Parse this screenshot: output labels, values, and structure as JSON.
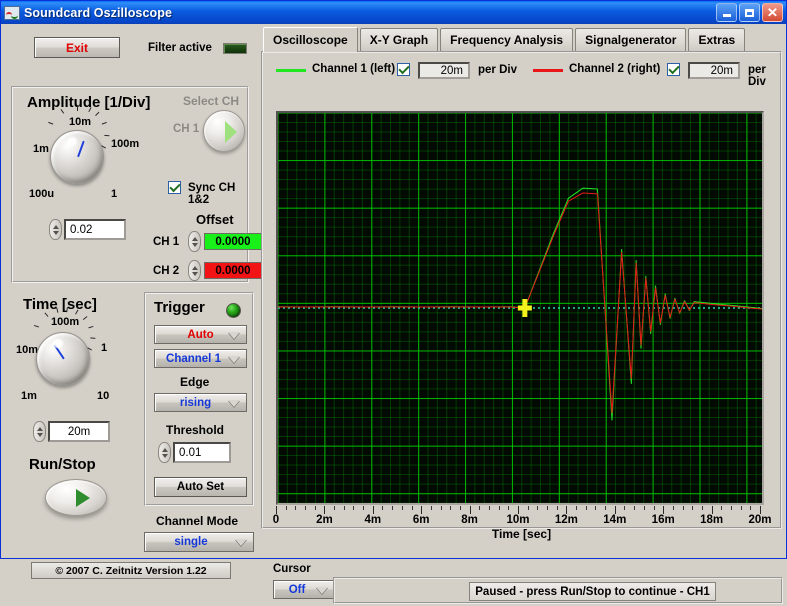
{
  "window": {
    "title": "Soundcard Oszilloscope",
    "icon": "oscilloscope-icon",
    "minimize": "minimize-icon",
    "maximize": "maximize-icon",
    "close": "✕"
  },
  "toolbar": {
    "exit_label": "Exit",
    "filter_label": "Filter active",
    "filter_led": "off"
  },
  "amplitude": {
    "title": "Amplitude [1/Div]",
    "knob_labels": [
      "1m",
      "10m",
      "100m",
      "1",
      "100u"
    ],
    "value": "0.02",
    "select_ch_label": "Select CH",
    "ch_label": "CH 1",
    "sync_label": "Sync CH 1&2",
    "sync_checked": true,
    "offset_title": "Offset",
    "ch1_label": "CH 1",
    "ch1_offset": "0.0000",
    "ch1_color": "#19f019",
    "ch2_label": "CH 2",
    "ch2_offset": "0.0000",
    "ch2_color": "#f21414"
  },
  "time": {
    "title": "Time [sec]",
    "knob_labels": [
      "10m",
      "100m",
      "1",
      "10",
      "1m"
    ],
    "value": "20m"
  },
  "runstop": {
    "title": "Run/Stop"
  },
  "trigger": {
    "title": "Trigger",
    "led": "on",
    "mode": "Auto",
    "source": "Channel 1",
    "edge_label": "Edge",
    "edge": "rising",
    "threshold_label": "Threshold",
    "threshold": "0.01",
    "autoset_label": "Auto Set"
  },
  "channel_mode": {
    "label": "Channel Mode",
    "value": "single"
  },
  "copyright": "© 2007   C. Zeitnitz Version 1.22",
  "tabs": [
    {
      "label": "Oscilloscope",
      "active": true
    },
    {
      "label": "X-Y Graph",
      "active": false
    },
    {
      "label": "Frequency Analysis",
      "active": false
    },
    {
      "label": "Signalgenerator",
      "active": false
    },
    {
      "label": "Extras",
      "active": false
    }
  ],
  "channels": [
    {
      "label": "Channel 1 (left)",
      "color": "#22e622",
      "enabled": true,
      "per_div": "20m",
      "per_div_label": "per Div"
    },
    {
      "label": "Channel 2 (right)",
      "color": "#e81616",
      "enabled": true,
      "per_div": "20m",
      "per_div_label": "per Div"
    }
  ],
  "cursor": {
    "label": "Cursor",
    "value": "Off"
  },
  "status": {
    "message": "Paused - press Run/Stop to continue - CH1"
  },
  "chart_data": {
    "type": "line",
    "title": "",
    "xlabel": "Time [sec]",
    "ylabel": "",
    "xlim": [
      0,
      0.02
    ],
    "ylim": [
      -0.08,
      0.08
    ],
    "xticks": [
      "0",
      "2m",
      "4m",
      "6m",
      "8m",
      "10m",
      "12m",
      "14m",
      "16m",
      "18m",
      "20m"
    ],
    "grid": true,
    "grid_color": "#00be00",
    "background": "#030a03",
    "legend_position": "top",
    "trigger_marker": {
      "x": 0.0102,
      "y": 0.0,
      "color": "#f2f21c"
    },
    "cursor_line": {
      "y": 0.0,
      "color": "#2ad8b0",
      "style": "dotted"
    },
    "series": [
      {
        "name": "Channel 1 (left)",
        "color": "#22e622",
        "x": [
          0.0,
          0.0012,
          0.0024,
          0.0036,
          0.0048,
          0.006,
          0.0072,
          0.0084,
          0.0096,
          0.0102,
          0.0108,
          0.0114,
          0.012,
          0.0126,
          0.0132,
          0.0138,
          0.0142,
          0.0146,
          0.0148,
          0.015,
          0.0152,
          0.0154,
          0.0156,
          0.0158,
          0.016,
          0.0162,
          0.0164,
          0.0166,
          0.0168,
          0.017,
          0.0172,
          0.0176,
          0.018,
          0.0184,
          0.0188,
          0.0192,
          0.0196,
          0.02
        ],
        "y": [
          0.0005,
          0.0004,
          0.0005,
          0.0004,
          0.0005,
          0.0004,
          0.0005,
          0.0004,
          0.0005,
          0.0,
          0.0155,
          0.031,
          0.045,
          0.0492,
          0.0488,
          -0.046,
          0.024,
          -0.031,
          0.0195,
          -0.0165,
          0.013,
          -0.0105,
          0.009,
          -0.0068,
          0.0058,
          -0.0042,
          0.004,
          -0.0022,
          0.003,
          -0.001,
          0.0026,
          0.0022,
          0.0018,
          0.0014,
          0.001,
          0.0006,
          0.0002,
          -0.0002
        ],
        "linewidth": 1
      },
      {
        "name": "Channel 2 (right)",
        "color": "#e81616",
        "x": [
          0.0,
          0.0012,
          0.0024,
          0.0036,
          0.0048,
          0.006,
          0.0072,
          0.0084,
          0.0096,
          0.0102,
          0.0108,
          0.0114,
          0.012,
          0.0126,
          0.0132,
          0.0138,
          0.0142,
          0.0146,
          0.0148,
          0.015,
          0.0152,
          0.0154,
          0.0156,
          0.0158,
          0.016,
          0.0162,
          0.0164,
          0.0166,
          0.0168,
          0.017,
          0.0172,
          0.0176,
          0.018,
          0.0184,
          0.0188,
          0.0192,
          0.0196,
          0.02
        ],
        "y": [
          0.0004,
          0.0004,
          0.0004,
          0.0004,
          0.0004,
          0.0004,
          0.0004,
          0.0004,
          0.0004,
          0.0,
          0.015,
          0.03,
          0.0438,
          0.0472,
          0.0468,
          -0.043,
          0.0228,
          -0.0288,
          0.0184,
          -0.0152,
          0.0122,
          -0.0096,
          0.0082,
          -0.0062,
          0.0052,
          -0.0038,
          0.0036,
          -0.002,
          0.0026,
          -0.0008,
          0.0022,
          0.0018,
          0.0014,
          0.0011,
          0.0007,
          0.0003,
          -0.0001,
          -0.0004
        ],
        "linewidth": 1
      }
    ]
  }
}
